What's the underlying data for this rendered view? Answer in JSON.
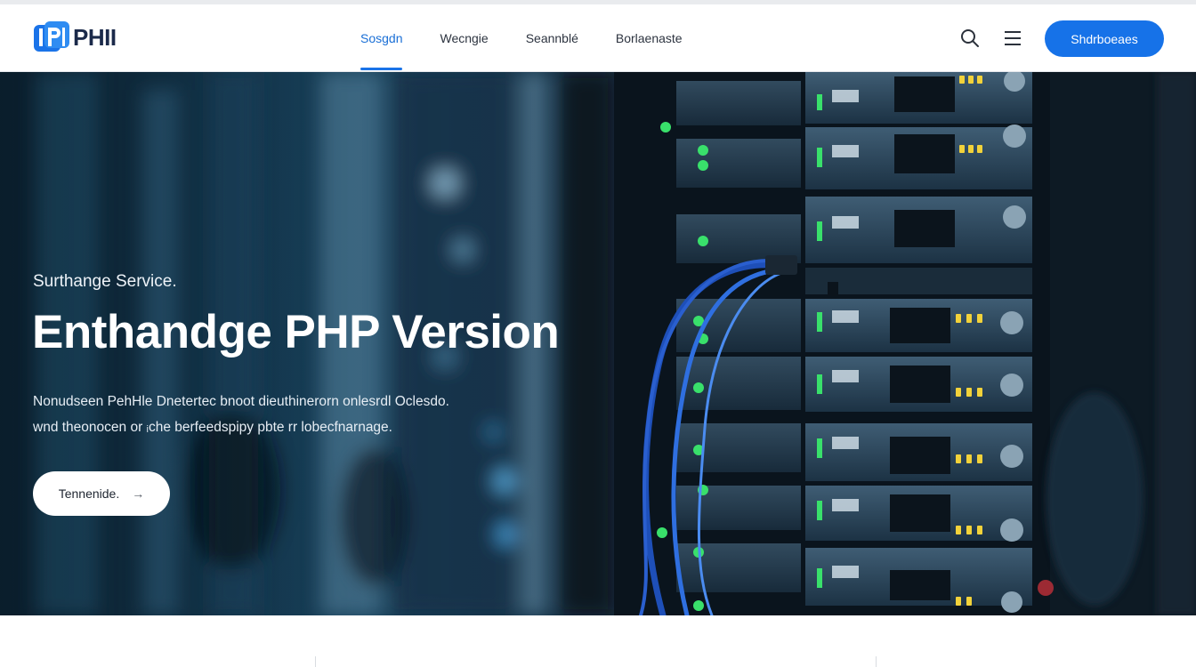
{
  "brand": {
    "name": "PHII",
    "mark_text": "P"
  },
  "nav": {
    "links": [
      {
        "label": "Sosgdn",
        "active": true
      },
      {
        "label": "Wecngie",
        "active": false
      },
      {
        "label": "Seannblé",
        "active": false
      },
      {
        "label": "Borlaenaste",
        "active": false
      }
    ],
    "search_icon": "search-icon",
    "menu_icon": "hamburger-menu-icon",
    "cta_label": "Shdrboeaes"
  },
  "hero": {
    "eyebrow": "Surthange Service.",
    "headline": "Enthandge PHP Version",
    "description_line1": "Nonudseen PehHle Dnetertec bnoot dieuthinerorn onlesrdl Oclesdo.",
    "description_line2": "wnd theonocen or ᵢche berfeedspipy pbte rr lobecfnarnage.",
    "button_label": "Tennenide.",
    "button_arrow": "→",
    "background": "server-rack-photo"
  },
  "colors": {
    "accent": "#1672e8",
    "nav_active": "#1a6fd6",
    "logo_blue": "#1a73e8",
    "hero_dark": "#0b1824",
    "status_green": "#39e06b",
    "status_yellow": "#f2d23a"
  }
}
